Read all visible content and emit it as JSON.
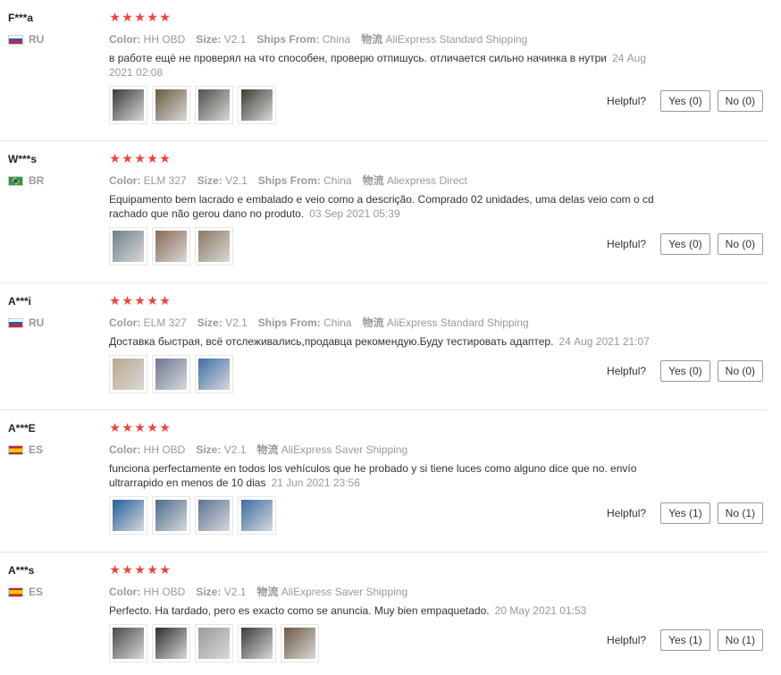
{
  "helpful_label": "Helpful?",
  "reviews": [
    {
      "user": "F***a",
      "country": "RU",
      "flag": "ru",
      "stars": [
        "★",
        "★",
        "★",
        "★",
        "★"
      ],
      "attrs": [
        {
          "label": "Color:",
          "value": "HH OBD"
        },
        {
          "label": "Size:",
          "value": "V2.1"
        },
        {
          "label": "Ships From:",
          "value": "China"
        },
        {
          "label": "物流",
          "value": "AliExpress Standard Shipping"
        }
      ],
      "text": "в работе ещё не проверял на что способен, проверю отпишусь. отличается сильно начинка в нутри",
      "date": "24 Aug 2021 02:08",
      "thumbs": [
        "#3a3a3a",
        "#6b5a3e",
        "#4d5249",
        "#3c3f35"
      ],
      "yes": "Yes (0)",
      "no": "No (0)"
    },
    {
      "user": "W***s",
      "country": "BR",
      "flag": "br",
      "stars": [
        "★",
        "★",
        "★",
        "★",
        "★"
      ],
      "attrs": [
        {
          "label": "Color:",
          "value": "ELM 327"
        },
        {
          "label": "Size:",
          "value": "V2.1"
        },
        {
          "label": "Ships From:",
          "value": "China"
        },
        {
          "label": "物流",
          "value": "Aliexpress Direct"
        }
      ],
      "text": "Equipamento bem lacrado e embalado e veio como a descrição. Comprado 02 unidades, uma delas veio com o cd rachado que não gerou dano no produto.",
      "date": "03 Sep 2021 05:39",
      "thumbs": [
        "#6f7f8a",
        "#8a6a55",
        "#8c7a63"
      ],
      "yes": "Yes (0)",
      "no": "No (0)"
    },
    {
      "user": "A***i",
      "country": "RU",
      "flag": "ru",
      "stars": [
        "★",
        "★",
        "★",
        "★",
        "★"
      ],
      "attrs": [
        {
          "label": "Color:",
          "value": "ELM 327"
        },
        {
          "label": "Size:",
          "value": "V2.1"
        },
        {
          "label": "Ships From:",
          "value": "China"
        },
        {
          "label": "物流",
          "value": "AliExpress Standard Shipping"
        }
      ],
      "text": "Доставка быстрая, всё отслеживались,продавца рекомендую.Буду тестировать адаптер.",
      "date": "24 Aug 2021 21:07",
      "thumbs": [
        "#b9a98c",
        "#6d7894",
        "#3e6ea8"
      ],
      "yes": "Yes (0)",
      "no": "No (0)"
    },
    {
      "user": "A***E",
      "country": "ES",
      "flag": "es",
      "stars": [
        "★",
        "★",
        "★",
        "★",
        "★"
      ],
      "attrs": [
        {
          "label": "Color:",
          "value": "HH OBD"
        },
        {
          "label": "Size:",
          "value": "V2.1"
        },
        {
          "label": "物流",
          "value": "AliExpress Saver Shipping"
        }
      ],
      "text": "funciona perfectamente en todos los vehículos que he probado y si tiene luces como alguno dice que no. envío ultrarrapido en menos de 10 dias",
      "date": "21 Jun 2021 23:56",
      "thumbs": [
        "#1f5f9c",
        "#4a6d8c",
        "#5a7494",
        "#3a6ea5"
      ],
      "yes": "Yes (1)",
      "no": "No (1)"
    },
    {
      "user": "A***s",
      "country": "ES",
      "flag": "es",
      "stars": [
        "★",
        "★",
        "★",
        "★",
        "★"
      ],
      "attrs": [
        {
          "label": "Color:",
          "value": "HH OBD"
        },
        {
          "label": "Size:",
          "value": "V2.1"
        },
        {
          "label": "物流",
          "value": "AliExpress Saver Shipping"
        }
      ],
      "text": "Perfecto. Ha tardado, pero es exacto como se anuncia. Muy bien empaquetado.",
      "date": "20 May 2021 01:53",
      "thumbs": [
        "#4a4a4a",
        "#2e2e2e",
        "#9a9a9a",
        "#3b3b3b",
        "#6e5a45"
      ],
      "yes": "Yes (1)",
      "no": "No (1)"
    }
  ]
}
